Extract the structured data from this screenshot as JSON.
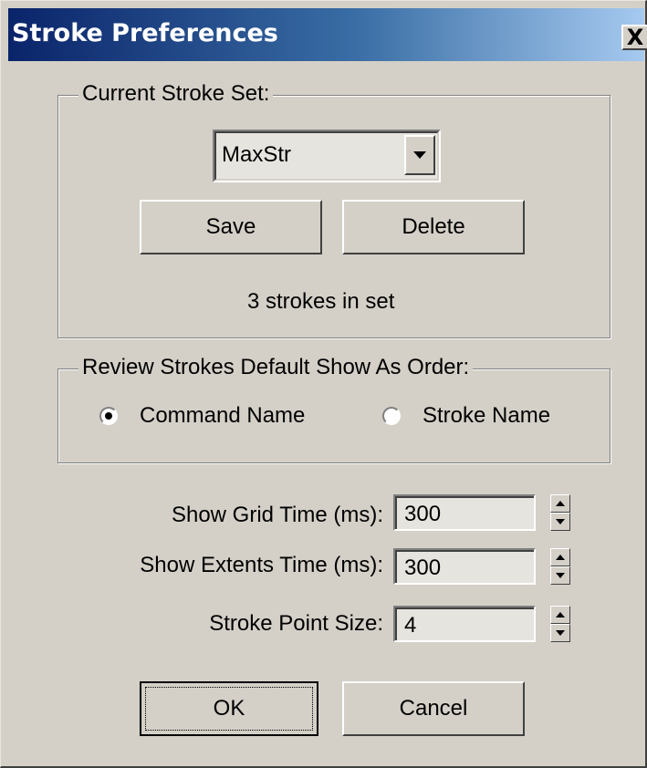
{
  "window": {
    "title": "Stroke Preferences",
    "close_label": "X"
  },
  "current_set": {
    "group_label": "Current Stroke Set:",
    "selected": "MaxStr",
    "save_label": "Save",
    "delete_label": "Delete",
    "status": "3 strokes in set"
  },
  "review": {
    "group_label": "Review Strokes Default Show As Order:",
    "options": [
      {
        "label": "Command Name",
        "selected": true
      },
      {
        "label": "Stroke Name",
        "selected": false
      }
    ]
  },
  "fields": [
    {
      "label": "Show Grid Time (ms):",
      "value": "300"
    },
    {
      "label": "Show Extents Time (ms):",
      "value": "300"
    },
    {
      "label": "Stroke Point Size:",
      "value": "4"
    }
  ],
  "buttons": {
    "ok_label": "OK",
    "cancel_label": "Cancel"
  }
}
